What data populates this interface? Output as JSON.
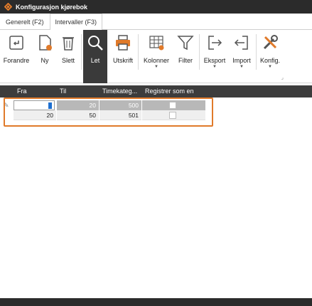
{
  "window": {
    "title": "Konfigurasjon kjørebok"
  },
  "tabs": [
    {
      "label": "Generelt (F2)"
    },
    {
      "label": "Intervaller (F3)"
    }
  ],
  "toolbar": {
    "buttons": [
      {
        "label": "Forandre",
        "icon": "edit-icon"
      },
      {
        "label": "Ny",
        "icon": "new-document-icon"
      },
      {
        "label": "Slett",
        "icon": "trash-icon"
      },
      {
        "label": "Let",
        "icon": "search-icon"
      },
      {
        "label": "Utskrift",
        "icon": "printer-icon"
      },
      {
        "label": "Kolonner",
        "icon": "columns-icon"
      },
      {
        "label": "Filter",
        "icon": "filter-icon"
      },
      {
        "label": "Eksport",
        "icon": "export-icon"
      },
      {
        "label": "Import",
        "icon": "import-icon"
      },
      {
        "label": "Konfig.",
        "icon": "tools-icon"
      }
    ]
  },
  "grid": {
    "columns": [
      "Fra",
      "Til",
      "Timekateg...",
      "Registrer som en"
    ],
    "rows": [
      {
        "fra": "",
        "til": "20",
        "timekategori": "500"
      },
      {
        "fra": "20",
        "til": "50",
        "timekategori": "501"
      }
    ]
  },
  "colors": {
    "accent": "#e07a2a",
    "header": "#3c3c3c",
    "titlebar": "#2b2b2b"
  }
}
